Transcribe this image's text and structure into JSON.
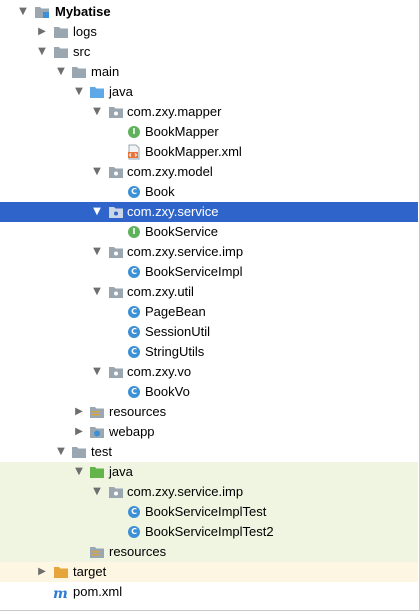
{
  "project": {
    "name": "Mybatise"
  },
  "folders": {
    "logs": "logs",
    "src": "src",
    "main": "main",
    "main_java": "java",
    "resources_main": "resources",
    "webapp": "webapp",
    "test": "test",
    "test_java": "java",
    "resources_test": "resources",
    "target": "target"
  },
  "packages": {
    "mapper": "com.zxy.mapper",
    "model": "com.zxy.model",
    "service": "com.zxy.service",
    "service_imp": "com.zxy.service.imp",
    "util": "com.zxy.util",
    "vo": "com.zxy.vo",
    "test_service_imp": "com.zxy.service.imp"
  },
  "files": {
    "book_mapper": "BookMapper",
    "book_mapper_xml": "BookMapper.xml",
    "book": "Book",
    "book_service": "BookService",
    "book_service_impl": "BookServiceImpl",
    "page_bean": "PageBean",
    "session_util": "SessionUtil",
    "string_utils": "StringUtils",
    "book_vo": "BookVo",
    "book_service_impl_test": "BookServiceImplTest",
    "book_service_impl_test2": "BookServiceImplTest2",
    "pom": "pom.xml"
  },
  "icons": {
    "class": "C",
    "interface": "I",
    "maven": "m"
  },
  "colors": {
    "selection": "#2f65ca",
    "test_bg": "#eff5e1",
    "excluded_bg": "#fcf6e2",
    "folder": "#9aa7b0",
    "source_folder": "#5fa8e8",
    "test_folder": "#63b54a",
    "class_icon": "#3d8fd6",
    "interface_icon": "#60b15b"
  }
}
